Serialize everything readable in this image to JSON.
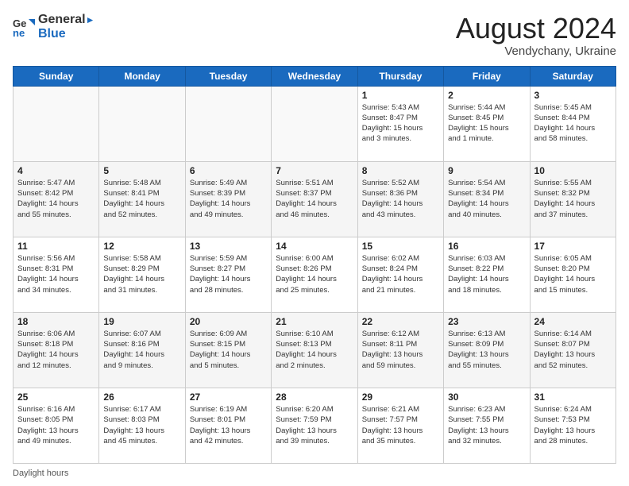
{
  "header": {
    "logo_line1": "General",
    "logo_line2": "Blue",
    "month_year": "August 2024",
    "location": "Vendychany, Ukraine"
  },
  "days_of_week": [
    "Sunday",
    "Monday",
    "Tuesday",
    "Wednesday",
    "Thursday",
    "Friday",
    "Saturday"
  ],
  "footer_label": "Daylight hours",
  "weeks": [
    [
      {
        "day": "",
        "info": ""
      },
      {
        "day": "",
        "info": ""
      },
      {
        "day": "",
        "info": ""
      },
      {
        "day": "",
        "info": ""
      },
      {
        "day": "1",
        "info": "Sunrise: 5:43 AM\nSunset: 8:47 PM\nDaylight: 15 hours\nand 3 minutes."
      },
      {
        "day": "2",
        "info": "Sunrise: 5:44 AM\nSunset: 8:45 PM\nDaylight: 15 hours\nand 1 minute."
      },
      {
        "day": "3",
        "info": "Sunrise: 5:45 AM\nSunset: 8:44 PM\nDaylight: 14 hours\nand 58 minutes."
      }
    ],
    [
      {
        "day": "4",
        "info": "Sunrise: 5:47 AM\nSunset: 8:42 PM\nDaylight: 14 hours\nand 55 minutes."
      },
      {
        "day": "5",
        "info": "Sunrise: 5:48 AM\nSunset: 8:41 PM\nDaylight: 14 hours\nand 52 minutes."
      },
      {
        "day": "6",
        "info": "Sunrise: 5:49 AM\nSunset: 8:39 PM\nDaylight: 14 hours\nand 49 minutes."
      },
      {
        "day": "7",
        "info": "Sunrise: 5:51 AM\nSunset: 8:37 PM\nDaylight: 14 hours\nand 46 minutes."
      },
      {
        "day": "8",
        "info": "Sunrise: 5:52 AM\nSunset: 8:36 PM\nDaylight: 14 hours\nand 43 minutes."
      },
      {
        "day": "9",
        "info": "Sunrise: 5:54 AM\nSunset: 8:34 PM\nDaylight: 14 hours\nand 40 minutes."
      },
      {
        "day": "10",
        "info": "Sunrise: 5:55 AM\nSunset: 8:32 PM\nDaylight: 14 hours\nand 37 minutes."
      }
    ],
    [
      {
        "day": "11",
        "info": "Sunrise: 5:56 AM\nSunset: 8:31 PM\nDaylight: 14 hours\nand 34 minutes."
      },
      {
        "day": "12",
        "info": "Sunrise: 5:58 AM\nSunset: 8:29 PM\nDaylight: 14 hours\nand 31 minutes."
      },
      {
        "day": "13",
        "info": "Sunrise: 5:59 AM\nSunset: 8:27 PM\nDaylight: 14 hours\nand 28 minutes."
      },
      {
        "day": "14",
        "info": "Sunrise: 6:00 AM\nSunset: 8:26 PM\nDaylight: 14 hours\nand 25 minutes."
      },
      {
        "day": "15",
        "info": "Sunrise: 6:02 AM\nSunset: 8:24 PM\nDaylight: 14 hours\nand 21 minutes."
      },
      {
        "day": "16",
        "info": "Sunrise: 6:03 AM\nSunset: 8:22 PM\nDaylight: 14 hours\nand 18 minutes."
      },
      {
        "day": "17",
        "info": "Sunrise: 6:05 AM\nSunset: 8:20 PM\nDaylight: 14 hours\nand 15 minutes."
      }
    ],
    [
      {
        "day": "18",
        "info": "Sunrise: 6:06 AM\nSunset: 8:18 PM\nDaylight: 14 hours\nand 12 minutes."
      },
      {
        "day": "19",
        "info": "Sunrise: 6:07 AM\nSunset: 8:16 PM\nDaylight: 14 hours\nand 9 minutes."
      },
      {
        "day": "20",
        "info": "Sunrise: 6:09 AM\nSunset: 8:15 PM\nDaylight: 14 hours\nand 5 minutes."
      },
      {
        "day": "21",
        "info": "Sunrise: 6:10 AM\nSunset: 8:13 PM\nDaylight: 14 hours\nand 2 minutes."
      },
      {
        "day": "22",
        "info": "Sunrise: 6:12 AM\nSunset: 8:11 PM\nDaylight: 13 hours\nand 59 minutes."
      },
      {
        "day": "23",
        "info": "Sunrise: 6:13 AM\nSunset: 8:09 PM\nDaylight: 13 hours\nand 55 minutes."
      },
      {
        "day": "24",
        "info": "Sunrise: 6:14 AM\nSunset: 8:07 PM\nDaylight: 13 hours\nand 52 minutes."
      }
    ],
    [
      {
        "day": "25",
        "info": "Sunrise: 6:16 AM\nSunset: 8:05 PM\nDaylight: 13 hours\nand 49 minutes."
      },
      {
        "day": "26",
        "info": "Sunrise: 6:17 AM\nSunset: 8:03 PM\nDaylight: 13 hours\nand 45 minutes."
      },
      {
        "day": "27",
        "info": "Sunrise: 6:19 AM\nSunset: 8:01 PM\nDaylight: 13 hours\nand 42 minutes."
      },
      {
        "day": "28",
        "info": "Sunrise: 6:20 AM\nSunset: 7:59 PM\nDaylight: 13 hours\nand 39 minutes."
      },
      {
        "day": "29",
        "info": "Sunrise: 6:21 AM\nSunset: 7:57 PM\nDaylight: 13 hours\nand 35 minutes."
      },
      {
        "day": "30",
        "info": "Sunrise: 6:23 AM\nSunset: 7:55 PM\nDaylight: 13 hours\nand 32 minutes."
      },
      {
        "day": "31",
        "info": "Sunrise: 6:24 AM\nSunset: 7:53 PM\nDaylight: 13 hours\nand 28 minutes."
      }
    ]
  ]
}
